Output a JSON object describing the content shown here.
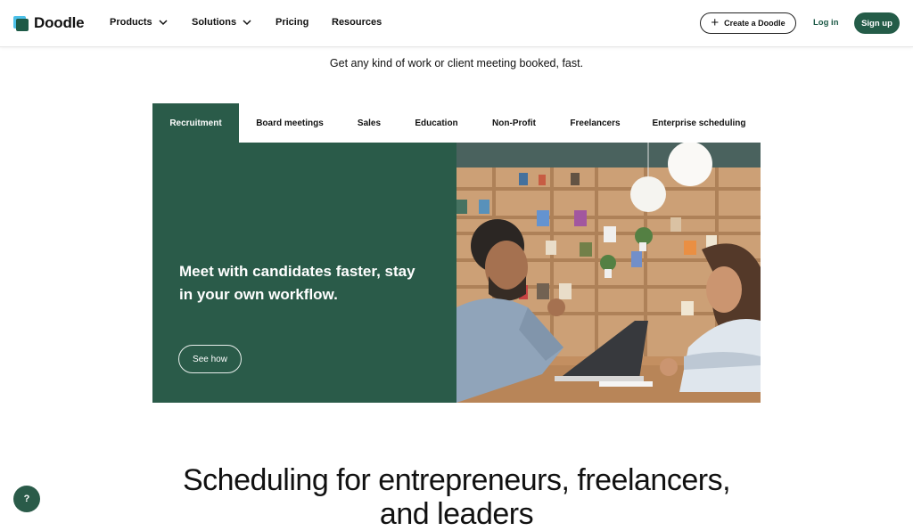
{
  "brand": {
    "name": "Doodle",
    "accent": "#2a5b49",
    "logo_colors": [
      "#4cc0e8",
      "#1d5a47"
    ]
  },
  "nav": {
    "items": [
      {
        "label": "Products",
        "has_dropdown": true
      },
      {
        "label": "Solutions",
        "has_dropdown": true
      },
      {
        "label": "Pricing",
        "has_dropdown": false
      },
      {
        "label": "Resources",
        "has_dropdown": false
      }
    ],
    "create_label": "Create a Doodle",
    "login_label": "Log in",
    "signup_label": "Sign up"
  },
  "hero": {
    "tagline": "Get any kind of work or client meeting booked, fast."
  },
  "tabs": [
    {
      "label": "Recruitment",
      "active": true
    },
    {
      "label": "Board meetings",
      "active": false
    },
    {
      "label": "Sales",
      "active": false
    },
    {
      "label": "Education",
      "active": false
    },
    {
      "label": "Non-Profit",
      "active": false
    },
    {
      "label": "Freelancers",
      "active": false
    },
    {
      "label": "Enterprise scheduling",
      "active": false
    }
  ],
  "panel": {
    "title": "Meet with candidates faster, stay in your own workflow.",
    "cta_label": "See how"
  },
  "section": {
    "headline_line1": "Scheduling for entrepreneurs, freelancers,",
    "headline_line2": "and leaders"
  },
  "help": {
    "label": "?"
  }
}
